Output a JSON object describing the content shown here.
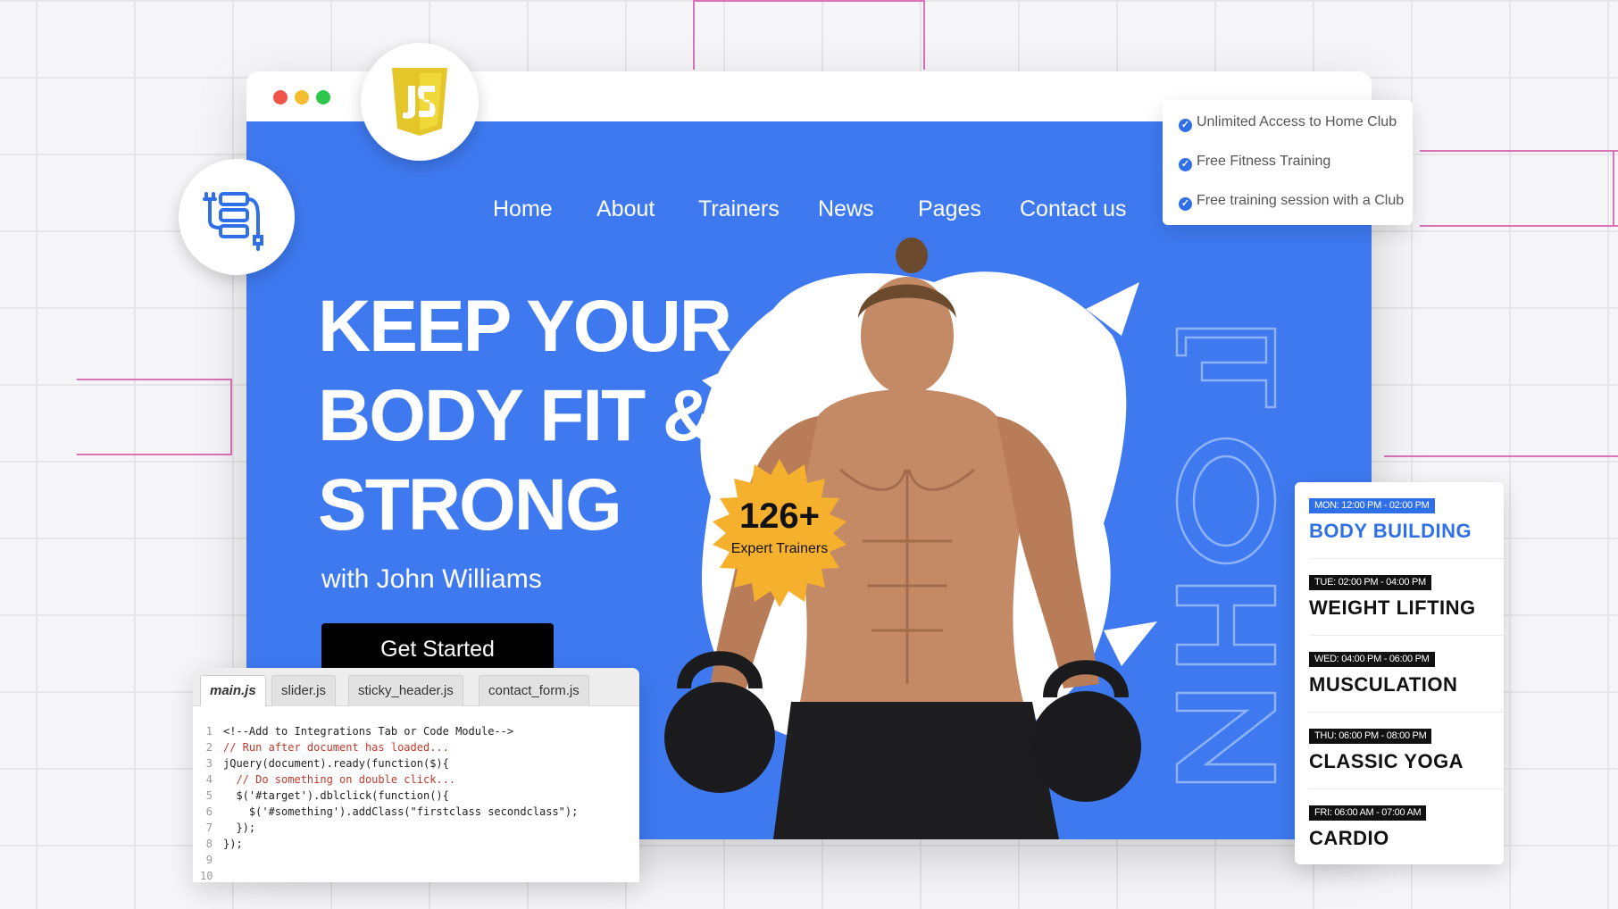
{
  "nav": {
    "items": [
      "Home",
      "About",
      "Trainers",
      "News",
      "Pages",
      "Contact us"
    ]
  },
  "hero": {
    "headline_lines": [
      "KEEP YOUR",
      "BODY FIT &",
      "STRONG"
    ],
    "subline": "with John Williams",
    "cta_label": "Get Started",
    "outline_word": "JOHN"
  },
  "trainers_badge": {
    "count": "126+",
    "label": "Expert Trainers"
  },
  "features": {
    "items": [
      "Unlimited Access to Home Club",
      "Free Fitness Training",
      "Free training session with a Club"
    ]
  },
  "schedule": {
    "slots": [
      {
        "time": "MON: 12:00 PM - 02:00 PM",
        "name": "BODY BUILDING"
      },
      {
        "time": "TUE: 02:00 PM - 04:00 PM",
        "name": "WEIGHT LIFTING"
      },
      {
        "time": "WED: 04:00 PM - 06:00 PM",
        "name": "MUSCULATION"
      },
      {
        "time": "THU: 06:00 PM - 08:00 PM",
        "name": "CLASSIC YOGA"
      },
      {
        "time": "FRI: 06:00 AM - 07:00 AM",
        "name": "CARDIO"
      }
    ]
  },
  "editor": {
    "tabs": [
      "main.js",
      "slider.js",
      "sticky_header.js",
      "contact_form.js"
    ],
    "lines": [
      {
        "n": "1",
        "text": "<!--Add to Integrations Tab or Code Module-->"
      },
      {
        "n": "2",
        "text": "// Run after document has loaded..."
      },
      {
        "n": "3",
        "text": "jQuery(document).ready(function($){"
      },
      {
        "n": "4",
        "text": "  // Do something on double click..."
      },
      {
        "n": "5",
        "text": "  $('#target').dblclick(function(){"
      },
      {
        "n": "6",
        "text": "    $('#something').addClass(\"firstclass secondclass\");"
      },
      {
        "n": "7",
        "text": "  });"
      },
      {
        "n": "8",
        "text": "});"
      },
      {
        "n": "9",
        "text": ""
      },
      {
        "n": "10",
        "text": ""
      }
    ]
  },
  "colors": {
    "hero_blue": "#3e79f0",
    "accent_blue": "#2f6fe8",
    "badge_yellow": "#f5b02e",
    "js_yellow": "#f0d83a",
    "dot_red": "#f0544a",
    "dot_yellow": "#f4bd2f",
    "dot_green": "#2fc74b"
  },
  "icons": [
    "javascript-logo-icon",
    "database-plug-icon",
    "check-circle-icon"
  ]
}
